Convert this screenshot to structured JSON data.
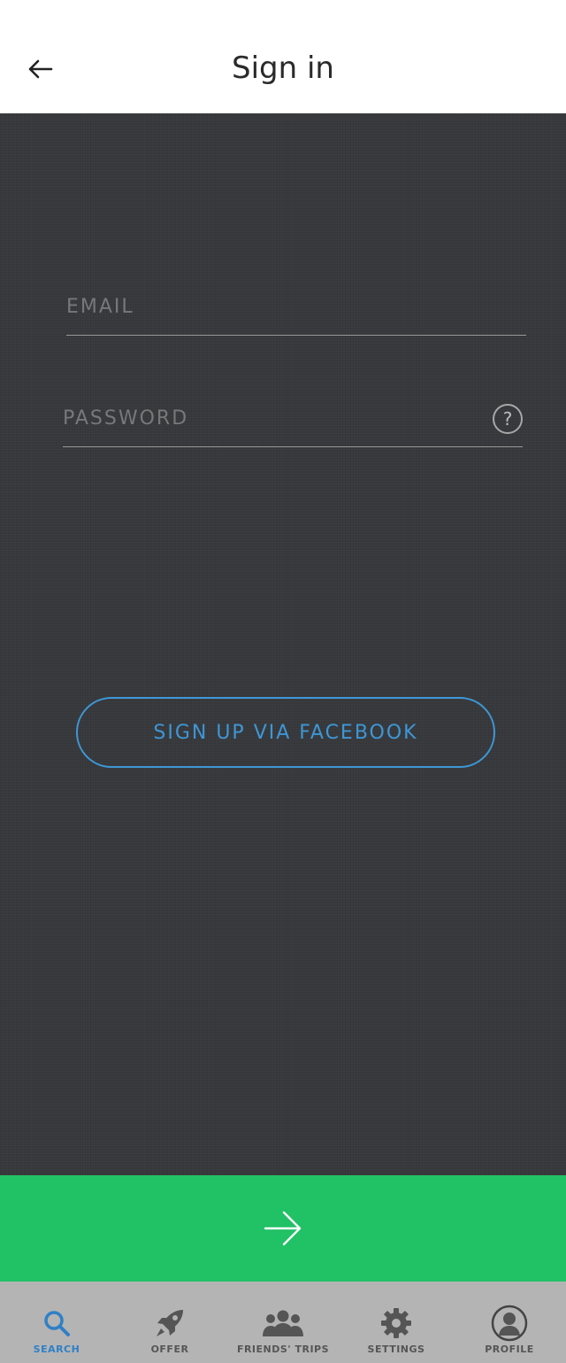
{
  "header": {
    "title": "Sign in",
    "back_icon": "arrow-left-icon"
  },
  "form": {
    "email": {
      "placeholder": "EMAIL",
      "value": ""
    },
    "password": {
      "placeholder": "PASSWORD",
      "value": ""
    },
    "help_glyph": "?",
    "facebook_button": "SIGN UP VIA FACEBOOK"
  },
  "next_button": {
    "icon": "arrow-right-icon"
  },
  "tabs": [
    {
      "label": "SEARCH",
      "icon": "search-icon",
      "active": true
    },
    {
      "label": "OFFER",
      "icon": "rocket-icon",
      "active": false
    },
    {
      "label": "FRIENDS' TRIPS",
      "icon": "group-icon",
      "active": false
    },
    {
      "label": "SETTINGS",
      "icon": "gear-icon",
      "active": false
    },
    {
      "label": "PROFILE",
      "icon": "user-icon",
      "active": false
    }
  ],
  "colors": {
    "background": "#38393c",
    "accent_blue": "#3d97d6",
    "next_green": "#21c165",
    "tabbar": "#b4b4b4"
  }
}
